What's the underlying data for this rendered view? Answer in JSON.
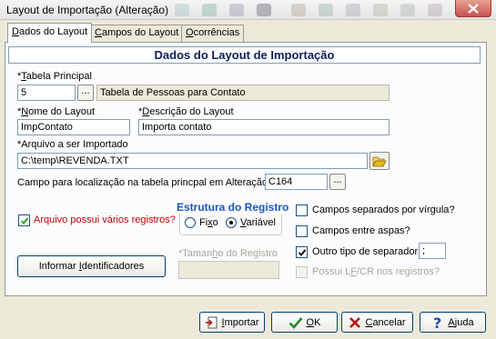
{
  "window": {
    "title": "Layout de Importação (Alteração)"
  },
  "tabs": [
    {
      "label_pre": "",
      "label_u": "D",
      "label_post": "ados do Layout"
    },
    {
      "label_pre": "",
      "label_u": "C",
      "label_post": "ampos do Layout"
    },
    {
      "label_pre": "",
      "label_u": "O",
      "label_post": "corrências"
    }
  ],
  "panel": {
    "header": "Dados do Layout de Importação"
  },
  "form": {
    "tabela_principal": {
      "label_pre": "*",
      "label_u": "T",
      "label_post": "abela Principal",
      "value": "5",
      "description": "Tabela de Pessoas para Contato"
    },
    "nome_layout": {
      "label_pre": "*",
      "label_u": "N",
      "label_post": "ome do Layout",
      "value": "ImpContato"
    },
    "descricao_layout": {
      "label_pre": "*",
      "label_u": "D",
      "label_post": "escrição do Layout",
      "value": "Importa contato"
    },
    "arquivo": {
      "label": "*Arquivo a ser Importado",
      "value": "C:\\temp\\REVENDA.TXT"
    },
    "campo_localizacao": {
      "label": "Campo para localização na tabela princpal em Alteração",
      "value": "C164"
    },
    "varios_registros": {
      "label": "Arquivo possui vários registros?",
      "checked": true,
      "label_color": "#c00000"
    },
    "estrutura": {
      "title": "Estrutura do Registro",
      "options": [
        {
          "label_pre": "Fi",
          "label_u": "x",
          "label_post": "o",
          "selected": false
        },
        {
          "label_pre": "",
          "label_u": "V",
          "label_post": "ariável",
          "selected": true
        }
      ]
    },
    "tamanho_registro": {
      "label": "*Taman",
      "label_u": "h",
      "label_post": "o do Registro",
      "value": ""
    },
    "campos_separados": {
      "label": "Campos separados por vírgula?",
      "checked": false
    },
    "campos_aspas": {
      "label": "Campos entre aspas?",
      "checked": false
    },
    "outro_separador": {
      "label": "Outro tipo de separador",
      "checked": true,
      "value": ";"
    },
    "possui_lf": {
      "label_pre": "Possui L",
      "label_u": "F",
      "label_post": "/CR nos registros?",
      "checked": false,
      "disabled": true
    }
  },
  "buttons": {
    "informar": {
      "label_pre": "Informar ",
      "label_u": "I",
      "label_post": "dentificadores"
    },
    "importar": {
      "label_pre": "",
      "label_u": "I",
      "label_post": "mportar"
    },
    "ok": {
      "label_pre": "",
      "label_u": "O",
      "label_post": "K"
    },
    "cancelar": {
      "label_pre": "",
      "label_u": "C",
      "label_post": "ancelar"
    },
    "ajuda": {
      "label_pre": "",
      "label_u": "A",
      "label_post": "juda"
    }
  },
  "colors": {
    "header_text": "#0c1e5b",
    "group_title": "#1a55c0",
    "ok_check": "#1f8a2a",
    "cancel_x": "#b01a1a",
    "help": "#1a4fc0"
  }
}
